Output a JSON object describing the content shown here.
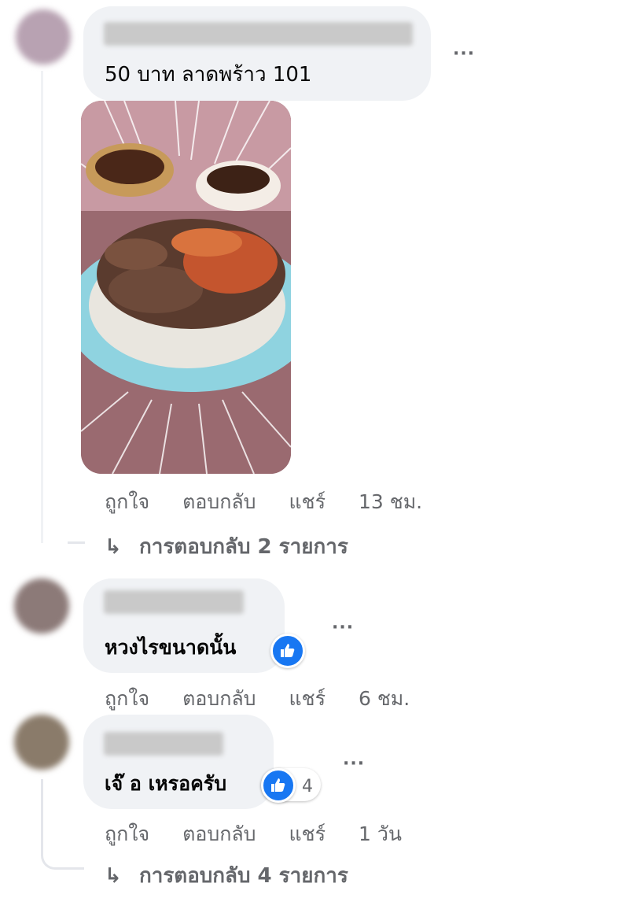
{
  "comments": [
    {
      "text": "50 บาท ลาดพร้าว 101",
      "actions": {
        "like": "ถูกใจ",
        "reply": "ตอบกลับ",
        "share": "แชร์",
        "time": "13 ชม."
      },
      "replies_label": "การตอบกลับ 2 รายการ"
    },
    {
      "text": "หวงไรขนาดนั้น",
      "actions": {
        "like": "ถูกใจ",
        "reply": "ตอบกลับ",
        "share": "แชร์",
        "time": "6 ชม."
      }
    },
    {
      "text": "เจ๊ อ เหรอครับ",
      "like_count": "4",
      "actions": {
        "like": "ถูกใจ",
        "reply": "ตอบกลับ",
        "share": "แชร์",
        "time": "1 วัน"
      },
      "replies_label": "การตอบกลับ 4 รายการ"
    }
  ],
  "more_label": "···",
  "reply_arrow": "↳",
  "icons": {
    "reaction": "like-thumb-icon",
    "more": "more-dots-icon"
  },
  "colors": {
    "accent": "#1877f2",
    "bubble": "#f0f2f5",
    "meta": "#65676b"
  }
}
